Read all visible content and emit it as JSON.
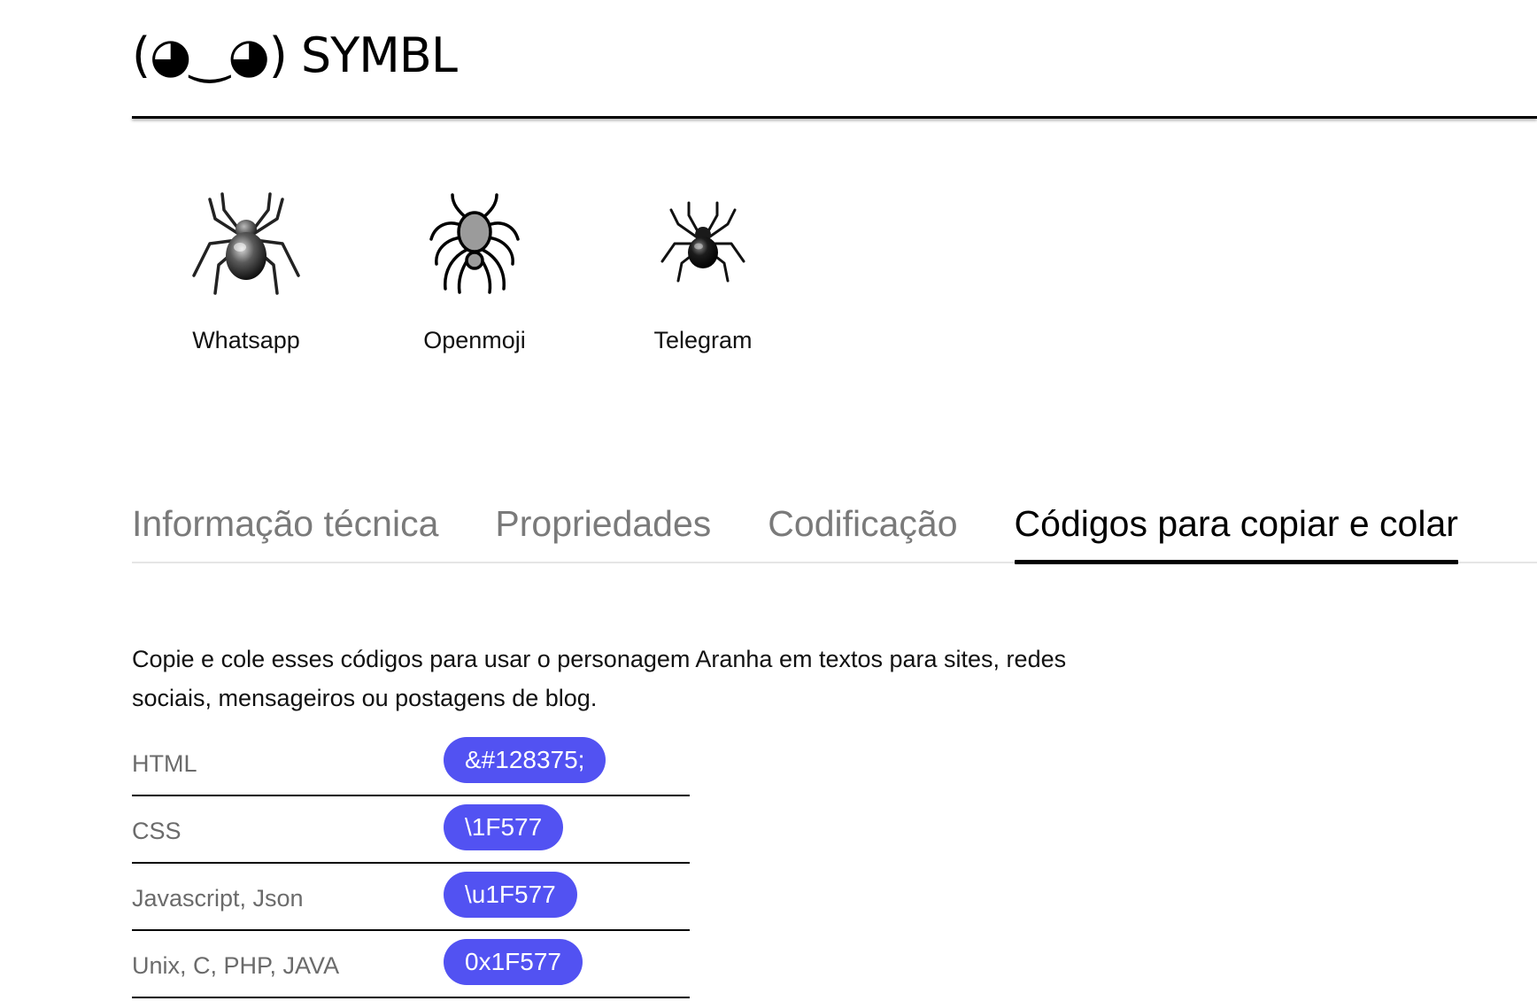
{
  "header": {
    "logo_text": "(◕‿◕) SYMBL"
  },
  "platforms": [
    {
      "label": "Whatsapp",
      "icon": "spider-icon"
    },
    {
      "label": "Openmoji",
      "icon": "spider-icon"
    },
    {
      "label": "Telegram",
      "icon": "spider-icon"
    }
  ],
  "tabs": [
    {
      "label": "Informação técnica",
      "active": false
    },
    {
      "label": "Propriedades",
      "active": false
    },
    {
      "label": "Codificação",
      "active": false
    },
    {
      "label": "Códigos para copiar e colar",
      "active": true
    }
  ],
  "description": "Copie e cole esses códigos para usar o personagem Aranha em textos para sites, redes sociais, mensageiros ou postagens de blog.",
  "codes": [
    {
      "label": "HTML",
      "value": "&#128375;"
    },
    {
      "label": "CSS",
      "value": "\\1F577"
    },
    {
      "label": "Javascript, Json",
      "value": "\\u1F577"
    },
    {
      "label": "Unix, C, PHP, JAVA",
      "value": "0x1F577"
    }
  ],
  "colors": {
    "pill_background": "#5252f2",
    "tab_inactive": "#7a7a7a",
    "tab_active": "#000000"
  }
}
